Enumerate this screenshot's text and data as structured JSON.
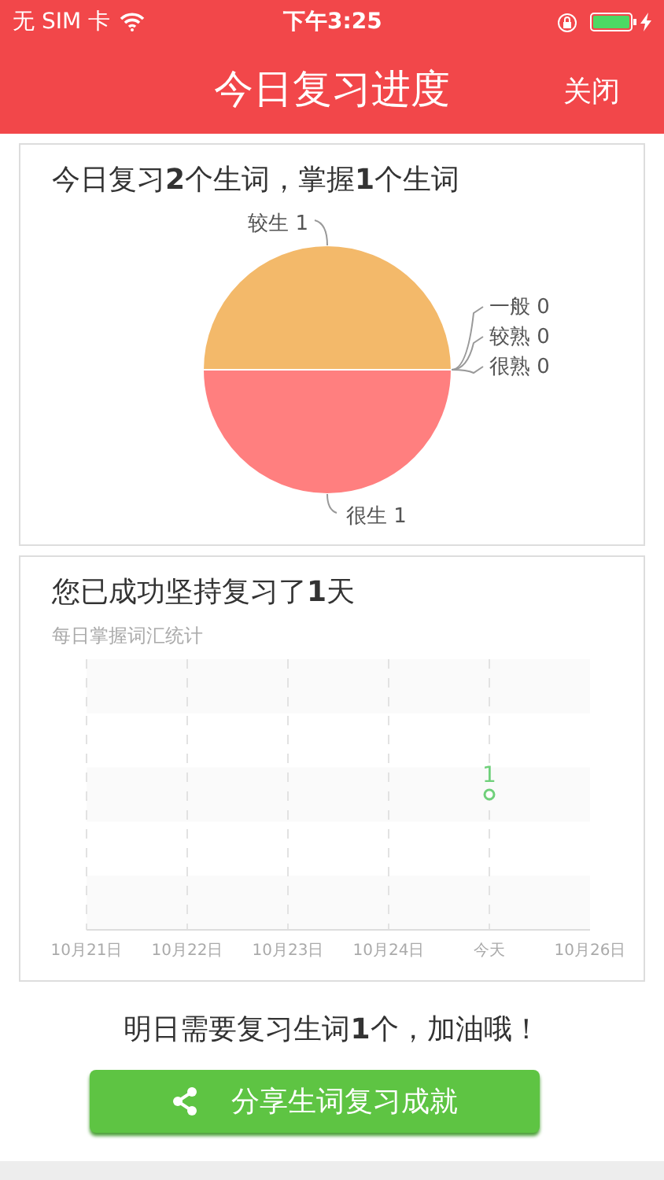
{
  "status_bar": {
    "carrier": "无 SIM 卡",
    "time": "下午3:25"
  },
  "nav": {
    "title": "今日复习进度",
    "close": "关闭"
  },
  "summary_card": {
    "headline": "今日复习**2**个生词，掌握**1**个生词",
    "chart_data": {
      "type": "pie",
      "categories": [
        "很生 1",
        "较生 1",
        "一般 0",
        "较熟 0",
        "很熟 0"
      ],
      "data_labels": true,
      "colors": [
        "#ff7f7f",
        "#f3b96a"
      ],
      "series": [
        {
          "values": [
            1,
            1,
            0,
            0,
            0
          ]
        }
      ]
    }
  },
  "streak_card": {
    "headline": "您已成功坚持复习了**1**天",
    "chart_title": "每日掌握词汇统计",
    "days": [
      {
        "label": "10月21日"
      },
      {
        "label": "10月22日"
      },
      {
        "label": "10月23日"
      },
      {
        "label": "10月24日"
      },
      {
        "label": "今天",
        "value": "1"
      },
      {
        "label": "10月26日"
      }
    ]
  },
  "tomorrow": "明日需要复习生词**1**个，加油哦！",
  "share_button": "分享生词复习成就"
}
